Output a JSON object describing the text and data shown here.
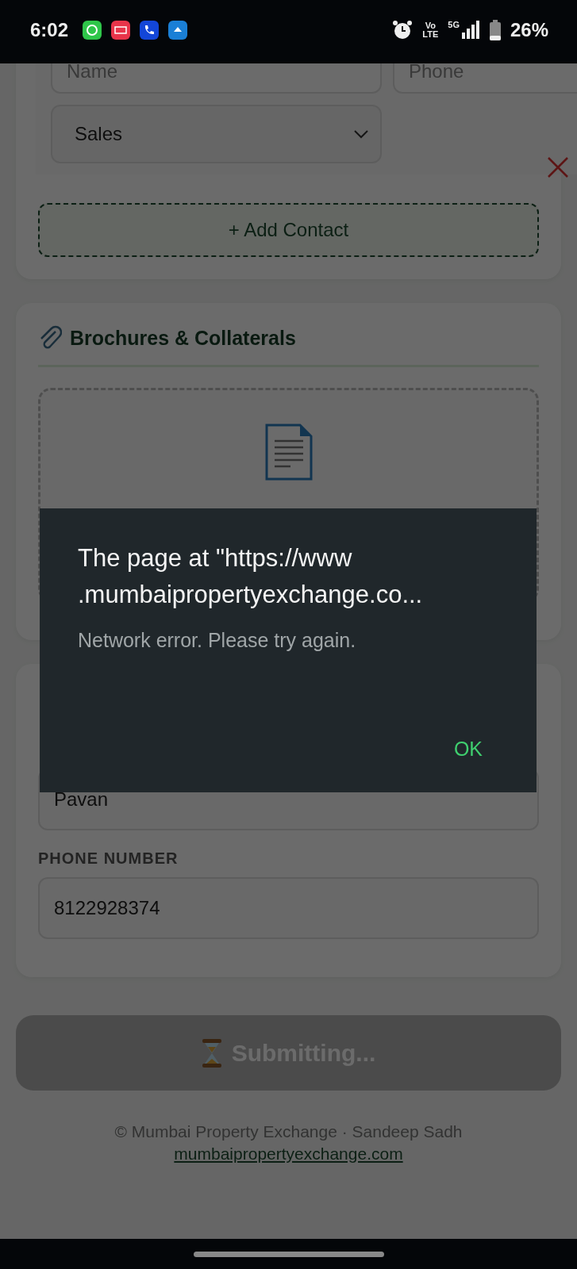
{
  "status_bar": {
    "time": "6:02",
    "volte_top": "Vo",
    "volte_bottom": "LTE",
    "network": "5G",
    "battery": "26%"
  },
  "contact": {
    "name_placeholder": "Name",
    "phone_placeholder": "Phone",
    "department": "Sales"
  },
  "add_contact_button": "+ Add Contact",
  "brochures": {
    "title": "Brochures & Collaterals"
  },
  "personal": {
    "name_value": "Pavan",
    "phone_label": "PHONE NUMBER",
    "phone_value": "8122928374"
  },
  "submit_button": {
    "label": "Submitting...",
    "disabled": true
  },
  "footer": {
    "copyright": "© Mumbai Property Exchange · Sandeep Sadh",
    "link": "mumbaipropertyexchange.com"
  },
  "dialog": {
    "title_lines": [
      "The page at \"https://www",
      ".mumbaipropertyexchange.co..."
    ],
    "message": "Network error. Please try again.",
    "ok_button": "OK"
  }
}
